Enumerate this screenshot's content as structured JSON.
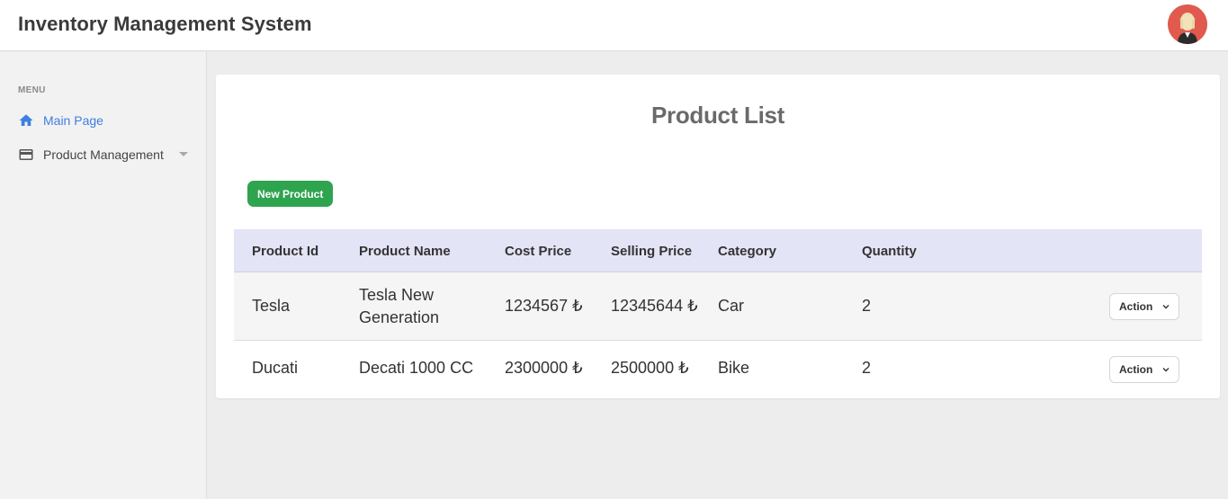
{
  "header": {
    "title": "Inventory Management System",
    "avatar_icon": "user-avatar"
  },
  "sidebar": {
    "menu_label": "MENU",
    "items": [
      {
        "label": "Main Page",
        "icon": "home-icon",
        "active": true,
        "color": "#3f7fe0"
      },
      {
        "label": "Product Management",
        "icon": "card-icon",
        "active": false,
        "has_dropdown": true
      }
    ]
  },
  "main": {
    "title": "Product List",
    "new_button_label": "New Product",
    "new_button_color": "#2ea44f",
    "table": {
      "columns": [
        "Product Id",
        "Product Name",
        "Cost Price",
        "Selling Price",
        "Category",
        "Quantity"
      ],
      "header_bg": "#e4e4f7",
      "rows": [
        {
          "id": "Tesla",
          "name": "Tesla New Generation",
          "cost": "1234567 ₺",
          "selling": "12345644 ₺",
          "category": "Car",
          "quantity": "2",
          "action": "Action"
        },
        {
          "id": "Ducati",
          "name": "Decati 1000 CC",
          "cost": "2300000 ₺",
          "selling": "2500000 ₺",
          "category": "Bike",
          "quantity": "2",
          "action": "Action"
        }
      ]
    }
  }
}
